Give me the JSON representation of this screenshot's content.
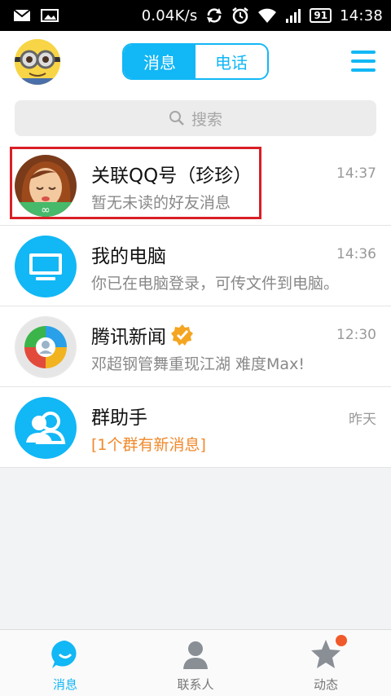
{
  "status_bar": {
    "network_speed": "0.04K/s",
    "battery": "91",
    "time": "14:38"
  },
  "header": {
    "tabs": [
      {
        "label": "消息",
        "active": true
      },
      {
        "label": "电话",
        "active": false
      }
    ]
  },
  "search": {
    "placeholder": "搜索"
  },
  "conversations": [
    {
      "title": "关联QQ号（珍珍）",
      "preview": "暂无未读的好友消息",
      "time": "14:37",
      "highlighted": true
    },
    {
      "title": "我的电脑",
      "preview": "你已在电脑登录，可传文件到电脑。",
      "time": "14:36"
    },
    {
      "title": "腾讯新闻",
      "preview": "邓超钢管舞重现江湖 难度Max!",
      "time": "12:30",
      "verified": true
    },
    {
      "title": "群助手",
      "preview": "[1个群有新消息]",
      "time": "昨天",
      "preview_color": "orange"
    }
  ],
  "bottom_nav": [
    {
      "label": "消息",
      "active": true
    },
    {
      "label": "联系人",
      "active": false
    },
    {
      "label": "动态",
      "active": false,
      "badge": true
    }
  ],
  "colors": {
    "accent": "#12b7f5",
    "highlight_border": "#d91f26",
    "badge": "#f05a2a",
    "orange_text": "#f0892b"
  }
}
